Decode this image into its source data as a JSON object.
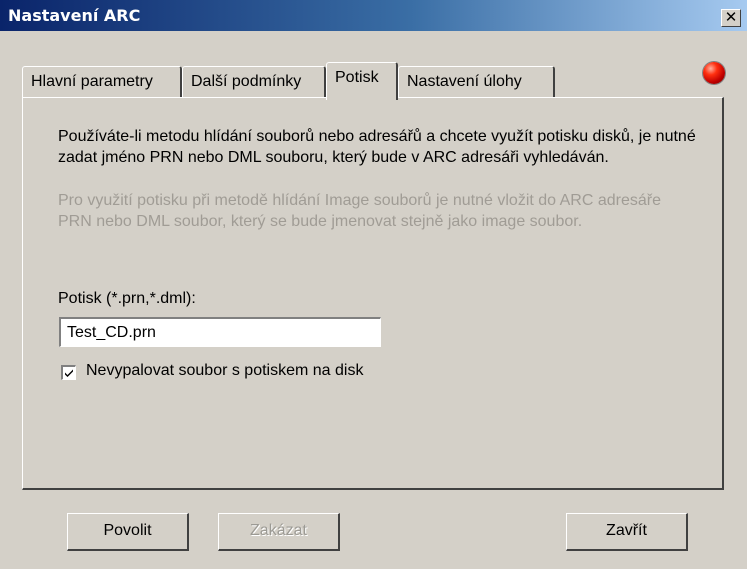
{
  "window": {
    "title": "Nastavení ARC",
    "close_glyph": "✕"
  },
  "tabs": [
    {
      "label": "Hlavní parametry"
    },
    {
      "label": "Další podmínky"
    },
    {
      "label": "Potisk",
      "active": true
    },
    {
      "label": "Nastavení úlohy"
    }
  ],
  "status_led": {
    "icon": "red-status-led-icon",
    "color": "#e00000"
  },
  "panel": {
    "description": "Používáte-li metodu hlídání souborů nebo adresářů a chcete využít potisku disků, je nutné zadat jméno PRN nebo DML souboru, který bude v ARC adresáři vyhledáván.",
    "description_disabled": "Pro využití potisku při metodě hlídání Image souborů je nutné vložit do ARC adresáře PRN nebo DML soubor, který se bude jmenovat stejně jako image soubor.",
    "field_label": "Potisk (*.prn,*.dml):",
    "field_value": "Test_CD.prn",
    "checkbox_label": "Nevypalovat soubor s potiskem na disk",
    "checkbox_checked": true
  },
  "buttons": {
    "enable": "Povolit",
    "disable": "Zakázat",
    "close": "Zavřít"
  }
}
